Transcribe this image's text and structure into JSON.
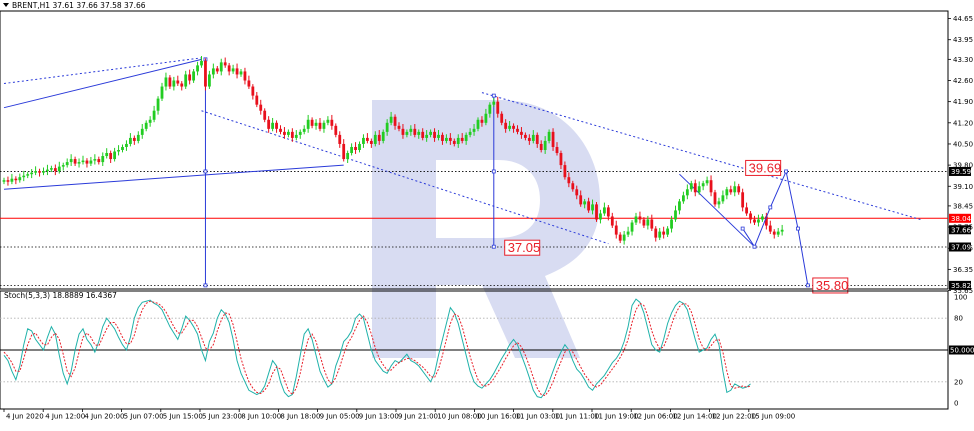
{
  "chart_data": [
    {
      "type": "candlestick",
      "header": "BRENT,H1  37.61 37.66 37.58 37.66",
      "ylim": [
        35.7,
        44.9
      ],
      "y_ticks": [
        "44.65",
        "43.95",
        "43.30",
        "42.60",
        "41.90",
        "41.20",
        "40.50",
        "39.80",
        "39.10",
        "38.45",
        "37.75",
        "37.05",
        "36.35",
        "35.65"
      ],
      "price_tags": [
        {
          "text": "39.59",
          "value": 39.59,
          "style": "dark"
        },
        {
          "text": "38.04",
          "value": 38.04,
          "style": "red"
        },
        {
          "text": "37.66",
          "value": 37.66,
          "style": "dark"
        },
        {
          "text": "37.09",
          "value": 37.09,
          "style": "dark"
        },
        {
          "text": "35.82",
          "value": 35.82,
          "style": "dark"
        }
      ],
      "horizontal_levels": [
        {
          "value": 39.59,
          "style": "dotted"
        },
        {
          "value": 38.04,
          "style": "solid-red"
        },
        {
          "value": 37.09,
          "style": "dotted"
        },
        {
          "value": 35.82,
          "style": "dotted"
        }
      ],
      "forecast_labels": [
        {
          "text": "39.69",
          "bar": 187,
          "value": 39.69
        },
        {
          "text": "37.05",
          "bar": 126,
          "value": 37.05
        },
        {
          "text": "35.80",
          "bar": 204,
          "value": 35.8
        }
      ],
      "forecast_path": [
        [
          187,
          37.7
        ],
        [
          190,
          37.1
        ],
        [
          194,
          38.4
        ],
        [
          198,
          39.59
        ],
        [
          201,
          37.7
        ],
        [
          203.5,
          35.82
        ]
      ],
      "trend_lines": [
        {
          "from": [
            0,
            41.7
          ],
          "to": [
            50,
            43.3
          ],
          "style": "solid"
        },
        {
          "from": [
            0,
            42.5
          ],
          "to": [
            50,
            43.35
          ],
          "style": "dotted"
        },
        {
          "from": [
            0,
            39.0
          ],
          "to": [
            86,
            39.8
          ],
          "style": "solid"
        },
        {
          "from": [
            50,
            41.6
          ],
          "to": [
            153,
            37.2
          ],
          "style": "dotted"
        },
        {
          "from": [
            121,
            42.2
          ],
          "to": [
            232,
            38.0
          ],
          "style": "dotted"
        },
        {
          "from": [
            171,
            39.5
          ],
          "to": [
            190,
            37.1
          ],
          "style": "solid"
        }
      ],
      "anchor_lines": [
        {
          "bar": 51,
          "values": [
            43.3,
            39.59,
            35.82
          ]
        },
        {
          "bar": 124,
          "values": [
            42.1,
            39.59,
            37.1
          ]
        }
      ],
      "closes": [
        39.3,
        39.25,
        39.35,
        39.3,
        39.4,
        39.45,
        39.5,
        39.55,
        39.6,
        39.55,
        39.6,
        39.65,
        39.7,
        39.6,
        39.75,
        39.8,
        39.9,
        40.0,
        39.85,
        39.9,
        39.95,
        39.85,
        39.95,
        40.0,
        39.9,
        40.1,
        40.2,
        40.0,
        40.25,
        40.3,
        40.4,
        40.5,
        40.7,
        40.6,
        40.8,
        41.0,
        41.2,
        41.3,
        41.6,
        42.0,
        42.4,
        42.7,
        42.4,
        42.6,
        42.5,
        42.4,
        42.8,
        42.6,
        42.9,
        43.1,
        43.25,
        42.4,
        42.8,
        43.0,
        42.9,
        43.2,
        43.1,
        42.9,
        43.0,
        42.8,
        42.9,
        42.6,
        42.4,
        42.1,
        41.8,
        41.6,
        41.3,
        41.0,
        41.2,
        41.0,
        40.9,
        40.8,
        40.9,
        40.7,
        40.8,
        40.9,
        41.0,
        41.3,
        41.1,
        41.2,
        41.0,
        41.2,
        41.3,
        41.1,
        40.8,
        40.5,
        40.0,
        40.2,
        40.4,
        40.3,
        40.5,
        40.7,
        40.6,
        40.5,
        40.8,
        40.6,
        40.9,
        41.2,
        41.4,
        41.1,
        41.0,
        40.8,
        40.9,
        41.0,
        40.8,
        40.9,
        40.7,
        40.8,
        40.9,
        40.7,
        40.8,
        40.6,
        40.7,
        40.6,
        40.5,
        40.7,
        40.6,
        40.8,
        40.9,
        41.0,
        41.3,
        41.2,
        41.5,
        41.8,
        41.9,
        41.5,
        41.2,
        41.0,
        41.1,
        41.0,
        40.9,
        40.8,
        40.7,
        40.6,
        40.8,
        40.5,
        40.3,
        40.6,
        40.9,
        40.4,
        40.2,
        39.8,
        39.4,
        39.2,
        39.0,
        38.8,
        38.5,
        38.6,
        38.3,
        38.5,
        38.0,
        38.2,
        38.4,
        38.1,
        37.8,
        37.5,
        37.3,
        37.5,
        37.6,
        37.9,
        38.1,
        38.0,
        37.8,
        38.0,
        37.7,
        37.4,
        37.6,
        37.5,
        37.7,
        38.0,
        38.3,
        38.6,
        38.8,
        39.0,
        39.2,
        38.9,
        39.1,
        39.2,
        39.3,
        38.9,
        38.5,
        38.6,
        38.8,
        39.0,
        38.9,
        39.1,
        38.9,
        38.4,
        38.2,
        38.0,
        37.9,
        38.0,
        38.1,
        37.8,
        37.6,
        37.5,
        37.6,
        37.66
      ],
      "x_tick_labels": [
        "4 Jun 2020",
        "4 Jun 12:00",
        "4 Jun 20:00",
        "5 Jun 07:00",
        "5 Jun 15:00",
        "5 Jun 23:00",
        "8 Jun 10:00",
        "8 Jun 18:00",
        "9 Jun 05:00",
        "9 Jun 13:00",
        "9 Jun 21:00",
        "10 Jun 08:00",
        "10 Jun 16:00",
        "11 Jun 03:00",
        "11 Jun 11:00",
        "11 Jun 19:00",
        "12 Jun 06:00",
        "12 Jun 14:00",
        "12 Jun 22:00",
        "15 Jun 09:00"
      ]
    },
    {
      "type": "line",
      "header": "Stoch(5,3,3) 18.8889 16.4367",
      "ylim": [
        0,
        100
      ],
      "y_ticks": [
        "100",
        "80",
        "20",
        "0"
      ],
      "level_tag": "50.0000",
      "levels": [
        80,
        50,
        20
      ],
      "series": [
        {
          "color": "#20b2aa",
          "values": [
            45,
            40,
            30,
            22,
            35,
            55,
            70,
            68,
            60,
            55,
            50,
            62,
            72,
            65,
            45,
            28,
            18,
            30,
            50,
            65,
            70,
            60,
            55,
            48,
            58,
            72,
            80,
            75,
            70,
            62,
            55,
            50,
            62,
            80,
            90,
            95,
            96,
            97,
            94,
            92,
            88,
            80,
            72,
            66,
            60,
            70,
            82,
            78,
            72,
            65,
            50,
            40,
            58,
            66,
            80,
            88,
            84,
            76,
            60,
            40,
            28,
            20,
            12,
            10,
            8,
            10,
            16,
            28,
            40,
            35,
            20,
            10,
            6,
            8,
            25,
            45,
            65,
            70,
            60,
            45,
            30,
            22,
            15,
            18,
            35,
            45,
            58,
            62,
            68,
            80,
            84,
            80,
            65,
            50,
            40,
            35,
            30,
            28,
            35,
            40,
            38,
            42,
            46,
            40,
            38,
            35,
            30,
            25,
            20,
            28,
            45,
            60,
            75,
            90,
            85,
            75,
            60,
            45,
            30,
            20,
            16,
            14,
            18,
            22,
            28,
            35,
            42,
            48,
            55,
            60,
            55,
            45,
            35,
            24,
            12,
            6,
            5,
            10,
            20,
            30,
            40,
            48,
            55,
            50,
            40,
            32,
            28,
            22,
            15,
            12,
            18,
            22,
            26,
            32,
            38,
            42,
            48,
            58,
            72,
            92,
            98,
            95,
            85,
            70,
            55,
            50,
            48,
            60,
            75,
            85,
            92,
            96,
            94,
            88,
            74,
            60,
            48,
            50,
            52,
            60,
            65,
            55,
            30,
            10,
            12,
            18,
            16,
            14,
            15,
            18
          ]
        },
        {
          "color": "#e8202a",
          "values": [
            48,
            44,
            38,
            30,
            30,
            42,
            55,
            64,
            66,
            60,
            55,
            55,
            62,
            66,
            60,
            46,
            30,
            25,
            33,
            48,
            62,
            66,
            62,
            55,
            54,
            62,
            70,
            76,
            76,
            70,
            62,
            56,
            56,
            64,
            78,
            88,
            94,
            96,
            95,
            94,
            91,
            86,
            79,
            72,
            66,
            66,
            72,
            78,
            78,
            72,
            62,
            52,
            50,
            55,
            68,
            78,
            85,
            84,
            74,
            58,
            42,
            30,
            20,
            14,
            10,
            9,
            12,
            18,
            28,
            34,
            32,
            22,
            12,
            8,
            14,
            28,
            46,
            60,
            65,
            58,
            45,
            32,
            22,
            18,
            24,
            34,
            46,
            56,
            62,
            70,
            78,
            82,
            76,
            65,
            52,
            42,
            36,
            31,
            31,
            35,
            38,
            40,
            42,
            42,
            40,
            37,
            34,
            30,
            25,
            24,
            32,
            45,
            60,
            75,
            84,
            82,
            72,
            58,
            44,
            32,
            22,
            17,
            16,
            18,
            23,
            29,
            35,
            42,
            48,
            54,
            57,
            53,
            45,
            35,
            24,
            14,
            8,
            7,
            12,
            20,
            30,
            39,
            48,
            51,
            48,
            41,
            34,
            27,
            22,
            17,
            15,
            17,
            22,
            27,
            32,
            37,
            43,
            50,
            60,
            76,
            88,
            94,
            92,
            82,
            68,
            58,
            51,
            53,
            62,
            74,
            84,
            91,
            94,
            93,
            86,
            74,
            60,
            52,
            50,
            54,
            59,
            60,
            48,
            30,
            16,
            14,
            15,
            16,
            15,
            16
          ]
        }
      ]
    }
  ],
  "colors": {
    "bull": "#22cc22",
    "bear": "#e8101c",
    "trend": "#2a3ad9",
    "accent": "#e8202a",
    "watermark": "#d8dcf2"
  }
}
